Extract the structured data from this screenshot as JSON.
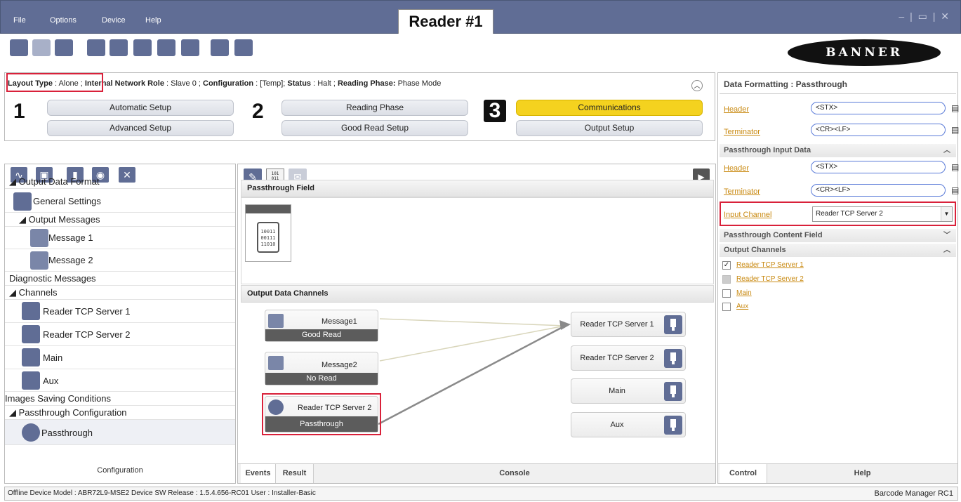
{
  "menu": [
    "File",
    "Options",
    "Device",
    "Help"
  ],
  "window_title": "Reader #1",
  "window_controls": "– | ▭ | ✕",
  "logo": "BANNER",
  "toolbar_icons": [
    "connect-icon",
    "find-device-icon",
    "device-settings-icon",
    "layout-icon",
    "save-to-device-icon",
    "load-from-device-icon",
    "export-icon",
    "import-icon",
    "job-icon",
    "network-icon"
  ],
  "status": {
    "layout_type_label": "Layout Type",
    "layout_type_value": ": Alone ;",
    "network_role_label": "Internal Network Role",
    "network_role_value": ": Slave 0 ;",
    "configuration_label": "Configuration",
    "configuration_value": ": [Temp];",
    "status_label": "Status",
    "status_value": ": Halt ;",
    "reading_phase_label": "Reading Phase:",
    "reading_phase_value": "Phase Mode"
  },
  "steps": [
    {
      "number": "1",
      "top": "Automatic Setup",
      "bottom": "Advanced Setup"
    },
    {
      "number": "2",
      "top": "Reading Phase",
      "bottom": "Good Read Setup"
    },
    {
      "number": "3",
      "top": "Communications",
      "bottom": "Output Setup"
    }
  ],
  "left_tools": [
    "diagnostics-icon",
    "image-saving-icon",
    "channel-icon",
    "passthrough-icon",
    "delete-icon"
  ],
  "tree": [
    {
      "label": "◢ Output Data Format"
    },
    {
      "label": "General Settings"
    },
    {
      "label": "◢ Output Messages"
    },
    {
      "label": "Message 1"
    },
    {
      "label": "Message 2"
    },
    {
      "label": "Diagnostic Messages"
    },
    {
      "label": "◢ Channels"
    },
    {
      "label": "Reader TCP Server 1"
    },
    {
      "label": "Reader TCP Server 2"
    },
    {
      "label": "Main"
    },
    {
      "label": "Aux"
    },
    {
      "label": "Images Saving Conditions"
    },
    {
      "label": "◢ Passthrough Configuration"
    },
    {
      "label": "Passthrough"
    }
  ],
  "left_footer": "Configuration",
  "center": {
    "passthrough_field_title": "Passthrough Field",
    "binary_icon_text": "10011\n00111\n11010",
    "output_channels_title": "Output Data Channels",
    "sources": [
      {
        "label": "Message1",
        "bar": "Good Read"
      },
      {
        "label": "Message2",
        "bar": "No Read"
      },
      {
        "label": "Reader TCP Server 2",
        "bar": "Passthrough"
      }
    ],
    "targets": [
      "Reader TCP Server 1",
      "Reader TCP Server 2",
      "Main",
      "Aux"
    ],
    "tabs": [
      "Events",
      "Result",
      "Console"
    ]
  },
  "right": {
    "title": "Data Formatting : Passthrough",
    "header_label": "Header",
    "header_value": "<STX>",
    "terminator_label": "Terminator",
    "terminator_value": "<CR><LF>",
    "passthrough_input_title": "Passthrough Input Data",
    "pi_header_label": "Header",
    "pi_header_value": "<STX>",
    "pi_terminator_label": "Terminator",
    "pi_terminator_value": "<CR><LF>",
    "input_channel_label": "Input Channel",
    "input_channel_value": "Reader TCP Server 2",
    "content_field_title": "Passthrough Content Field",
    "output_channels_title": "Output Channels",
    "output_channels": [
      {
        "label": "Reader TCP Server 1",
        "checked": true
      },
      {
        "label": "Reader TCP Server 2",
        "checked": false
      },
      {
        "label": "Main",
        "checked": false
      },
      {
        "label": "Aux",
        "checked": false
      }
    ],
    "tabs": [
      "Control",
      "Help"
    ]
  },
  "bottom": {
    "left": "Offline Device Model : ABR72L9-MSE2   Device SW Release : 1.5.4.656-RC01   User : Installer-Basic",
    "right": "Barcode Manager RC1"
  },
  "colors": {
    "accent": "#606d95",
    "active_step": "#f4d21f",
    "highlight": "#d9213a",
    "link": "#c98a12"
  }
}
